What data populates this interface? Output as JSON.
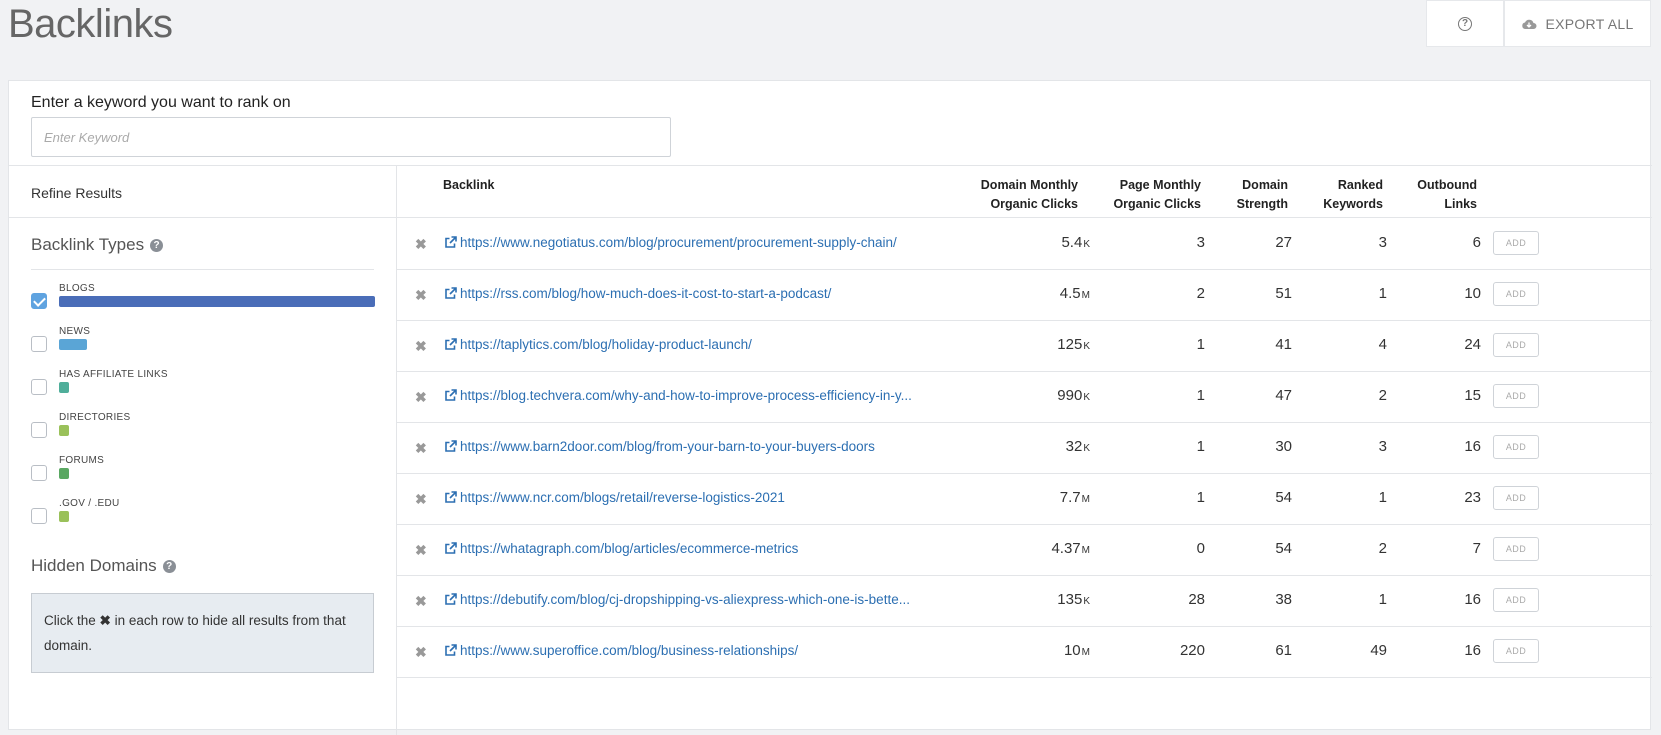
{
  "header": {
    "title": "Backlinks",
    "export_label": "EXPORT ALL"
  },
  "search": {
    "label": "Enter a keyword you want to rank on",
    "value": "",
    "placeholder": "Enter Keyword"
  },
  "sidebar": {
    "refine_title": "Refine Results",
    "types_title": "Backlink Types",
    "types": [
      {
        "label": "BLOGS",
        "checked": true,
        "color": "#4a6db8",
        "level": 1.0
      },
      {
        "label": "NEWS",
        "checked": false,
        "color": "#5aa5d6",
        "level": 0.09
      },
      {
        "label": "HAS AFFILIATE LINKS",
        "checked": false,
        "color": "#4fae9a",
        "level": 0.03
      },
      {
        "label": "DIRECTORIES",
        "checked": false,
        "color": "#9ac15a",
        "level": 0.03
      },
      {
        "label": "FORUMS",
        "checked": false,
        "color": "#5aa862",
        "level": 0.03
      },
      {
        "label": ".GOV / .EDU",
        "checked": false,
        "color": "#9ac15a",
        "level": 0.03
      }
    ],
    "hidden_title": "Hidden Domains",
    "hint_before": "Click the ",
    "hint_icon": "✖",
    "hint_after": " in each row to hide all results from that domain."
  },
  "table": {
    "headers": {
      "backlink": "Backlink",
      "domain_clicks": "Domain Monthly Organic Clicks",
      "page_clicks": "Page Monthly Organic Clicks",
      "strength": "Domain Strength",
      "keywords": "Ranked Keywords",
      "outbound": "Outbound Links"
    },
    "add_label": "ADD",
    "rows": [
      {
        "url": "https://www.negotiatus.com/blog/procurement/procurement-supply-chain/",
        "dc": "5.4",
        "du": "K",
        "pc": "3",
        "ds": "27",
        "rk": "3",
        "ol": "6"
      },
      {
        "url": "https://rss.com/blog/how-much-does-it-cost-to-start-a-podcast/",
        "dc": "4.5",
        "du": "M",
        "pc": "2",
        "ds": "51",
        "rk": "1",
        "ol": "10"
      },
      {
        "url": "https://taplytics.com/blog/holiday-product-launch/",
        "dc": "125",
        "du": "K",
        "pc": "1",
        "ds": "41",
        "rk": "4",
        "ol": "24"
      },
      {
        "url": "https://blog.techvera.com/why-and-how-to-improve-process-efficiency-in-y...",
        "dc": "990",
        "du": "K",
        "pc": "1",
        "ds": "47",
        "rk": "2",
        "ol": "15"
      },
      {
        "url": "https://www.barn2door.com/blog/from-your-barn-to-your-buyers-doors",
        "dc": "32",
        "du": "K",
        "pc": "1",
        "ds": "30",
        "rk": "3",
        "ol": "16"
      },
      {
        "url": "https://www.ncr.com/blogs/retail/reverse-logistics-2021",
        "dc": "7.7",
        "du": "M",
        "pc": "1",
        "ds": "54",
        "rk": "1",
        "ol": "23"
      },
      {
        "url": "https://whatagraph.com/blog/articles/ecommerce-metrics",
        "dc": "4.37",
        "du": "M",
        "pc": "0",
        "ds": "54",
        "rk": "2",
        "ol": "7"
      },
      {
        "url": "https://debutify.com/blog/cj-dropshipping-vs-aliexpress-which-one-is-bette...",
        "dc": "135",
        "du": "K",
        "pc": "28",
        "ds": "38",
        "rk": "1",
        "ol": "16"
      },
      {
        "url": "https://www.superoffice.com/blog/business-relationships/",
        "dc": "10",
        "du": "M",
        "pc": "220",
        "ds": "61",
        "rk": "49",
        "ol": "16"
      }
    ]
  }
}
